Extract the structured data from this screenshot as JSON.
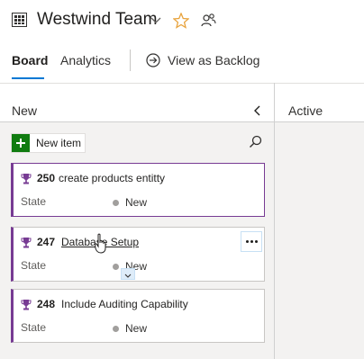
{
  "header": {
    "team_name": "Westwind Team",
    "tabs": [
      {
        "label": "Board",
        "selected": true
      },
      {
        "label": "Analytics",
        "selected": false
      }
    ],
    "view_as_backlog_label": "View as Backlog"
  },
  "columns": [
    {
      "title": "New"
    },
    {
      "title": "Active"
    }
  ],
  "new_item_label": "New item",
  "cards": [
    {
      "id": "250",
      "title": "create products entitty",
      "state_label": "State",
      "state_value": "New"
    },
    {
      "id": "247",
      "title": "Database Setup",
      "state_label": "State",
      "state_value": "New"
    },
    {
      "id": "248",
      "title": "Include Auditing Capability",
      "state_label": "State",
      "state_value": "New"
    }
  ],
  "colors": {
    "accent": "#0078d4",
    "work_item_type": "#773b93",
    "new_item_green": "#107c10",
    "state_new_dot": "#a19f9d",
    "favorite_star": "#e8a33d"
  },
  "icons": [
    "team-icon",
    "chevron-down-icon",
    "star-icon",
    "team-members-icon",
    "arrow-circle-right-icon",
    "chevron-left-icon",
    "plus-icon",
    "search-icon",
    "trophy-icon",
    "more-icon",
    "chevron-down-small-icon",
    "hand-cursor-icon"
  ]
}
